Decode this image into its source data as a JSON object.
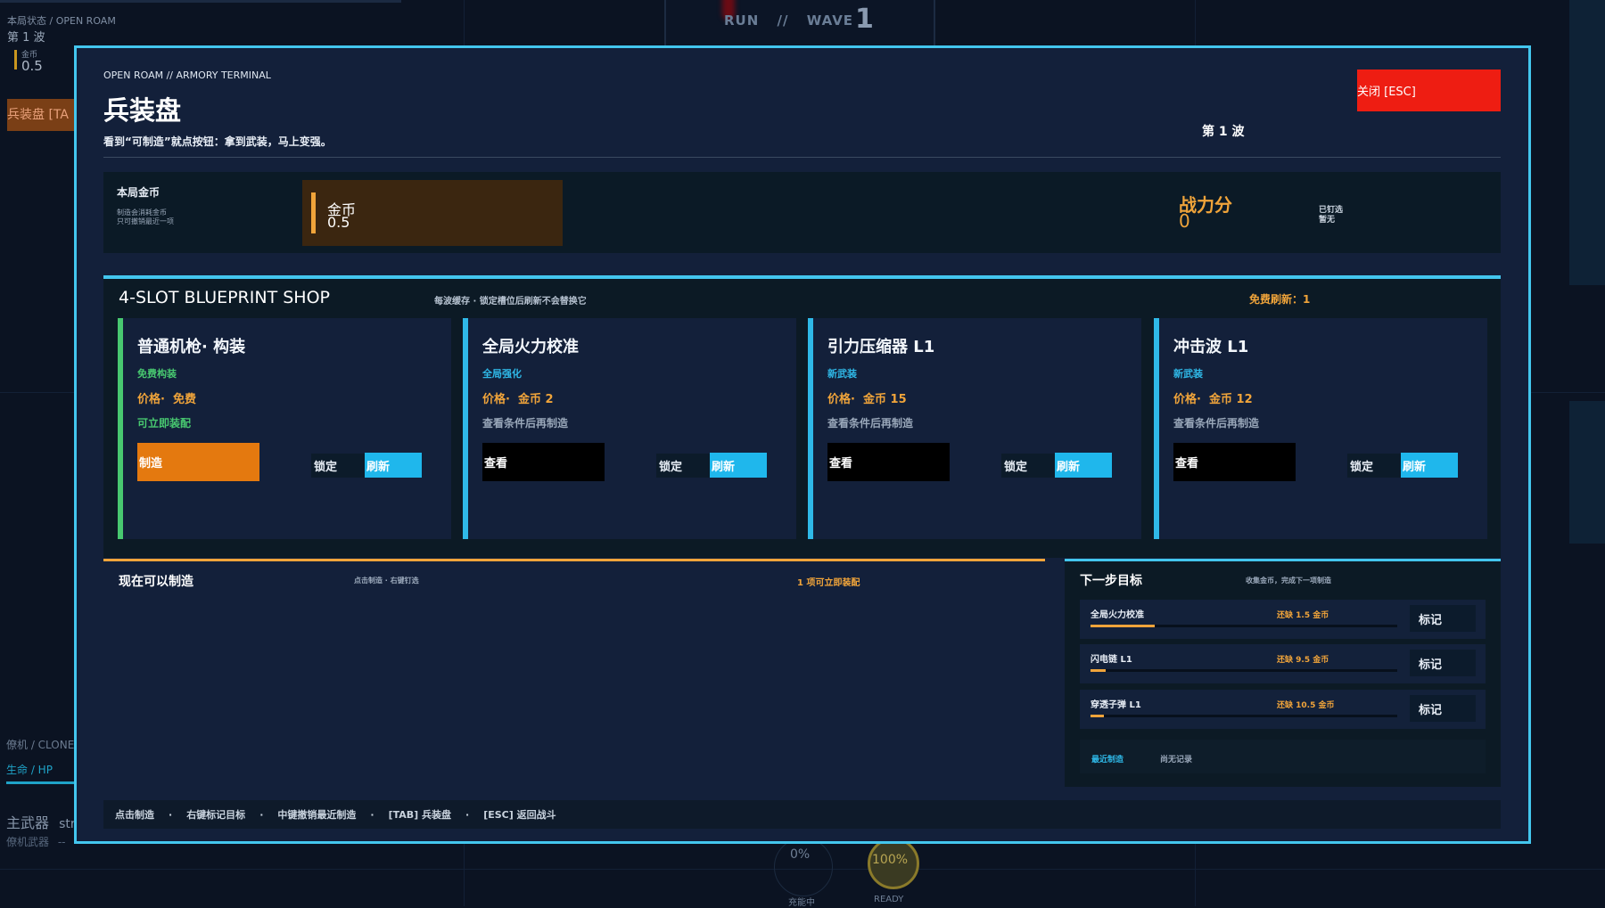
{
  "hud": {
    "status_label": "本局状态",
    "status_sep": "/",
    "mode": "OPEN ROAM",
    "wave_label": "第 1 波",
    "gold_mini_label": "金币",
    "gold_mini_value": "0.5",
    "armory_tab": "兵装盘 [TA",
    "run_label": "RUN",
    "run_sep": "//",
    "wave_word": "WAVE",
    "wave_number": "1",
    "clone_label": "僚机 / CLONE",
    "hp_label": "生命 / HP",
    "primary_label": "主武器",
    "primary_value": "str",
    "wing_weapon_label": "僚机武器",
    "wing_weapon_value": "--",
    "charge_percent": "0%",
    "charge_label": "充能中",
    "ready_percent": "100%",
    "ready_label": "READY"
  },
  "modal": {
    "kicker": "OPEN ROAM // ARMORY TERMINAL",
    "title": "兵装盘",
    "subtitle": "看到“可制造”就点按钮：拿到武装，马上变强。",
    "wave": "第 1 波",
    "close_button": "关闭 [ESC]"
  },
  "summary": {
    "gold_title": "本局金币",
    "gold_note_1": "制造会消耗金币",
    "gold_note_2": "只可撤销最近一项",
    "gold_label": "金币",
    "gold_value": "0.5",
    "power_label": "战力分",
    "power_value": "0",
    "pinned_label": "已钉选",
    "pinned_value": "暂无"
  },
  "shop": {
    "title": "4-SLOT BLUEPRINT SHOP",
    "hint": "每波缓存 · 锁定槽位后刷新不会替换它",
    "free_refresh": "免费刷新：1",
    "cards": [
      {
        "name": "普通机枪· 构装",
        "tag": "免费构装",
        "price_label": "价格·",
        "price": "免费",
        "note": "可立即装配",
        "action": "制造",
        "lock": "锁定",
        "refresh": "刷新"
      },
      {
        "name": "全局火力校准",
        "tag": "全局强化",
        "price_label": "价格·",
        "price": "金币 2",
        "note": "查看条件后再制造",
        "action": "查看",
        "lock": "锁定",
        "refresh": "刷新"
      },
      {
        "name": "引力压缩器 L1",
        "tag": "新武装",
        "price_label": "价格·",
        "price": "金币 15",
        "note": "查看条件后再制造",
        "action": "查看",
        "lock": "锁定",
        "refresh": "刷新"
      },
      {
        "name": "冲击波 L1",
        "tag": "新武装",
        "price_label": "价格·",
        "price": "金币 12",
        "note": "查看条件后再制造",
        "action": "查看",
        "lock": "锁定",
        "refresh": "刷新"
      }
    ],
    "colors": {
      "accent_green": "#48c870",
      "accent_blue": "#2fb9e8",
      "accent_orange": "#f0a43a",
      "close_red": "#ee1d12"
    }
  },
  "craftable": {
    "title": "现在可以制造",
    "hint": "点击制造 · 右键钉选",
    "count": "1 项可立即装配"
  },
  "next": {
    "title": "下一步目标",
    "hint": "收集金币，完成下一项制造",
    "goals": [
      {
        "name": "全局火力校准",
        "missing": "还缺 1.5 金币",
        "progress": 0.21,
        "mark": "标记"
      },
      {
        "name": "闪电链 L1",
        "missing": "还缺 9.5 金币",
        "progress": 0.05,
        "mark": "标记"
      },
      {
        "name": "穿透子弹 L1",
        "missing": "还缺 10.5 金币",
        "progress": 0.045,
        "mark": "标记"
      }
    ],
    "recent_label": "最近制造",
    "recent_value": "尚无记录"
  },
  "footer": {
    "items": [
      "点击制造",
      "右键标记目标",
      "中键撤销最近制造",
      "[TAB] 兵装盘",
      "[ESC] 返回战斗"
    ],
    "sep": "·"
  }
}
